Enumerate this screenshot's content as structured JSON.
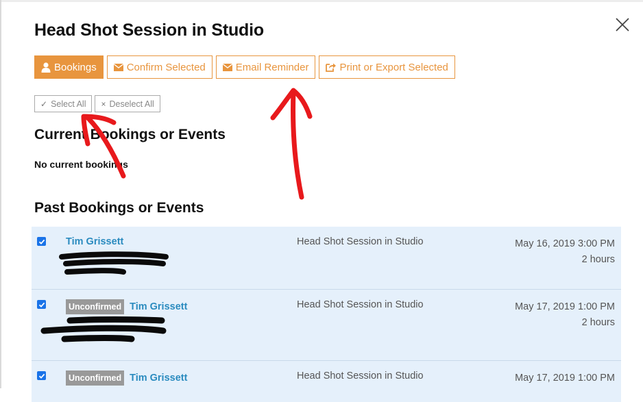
{
  "modal": {
    "title": "Head Shot Session in Studio"
  },
  "toolbar": {
    "bookings_label": "Bookings",
    "confirm_label": "Confirm Selected",
    "email_label": "Email Reminder",
    "print_label": "Print or Export Selected"
  },
  "selection": {
    "select_all": "Select All",
    "deselect_all": "Deselect All"
  },
  "current": {
    "heading": "Current Bookings or Events",
    "empty": "No current bookings"
  },
  "past": {
    "heading": "Past Bookings or Events",
    "rows": [
      {
        "checked": true,
        "badge": "",
        "name": "Tim Grissett",
        "service": "Head Shot Session in Studio",
        "datetime": "May 16, 2019 3:00 PM",
        "duration": "2 hours"
      },
      {
        "checked": true,
        "badge": "Unconfirmed",
        "name": "Tim Grissett",
        "service": "Head Shot Session in Studio",
        "datetime": "May 17, 2019 1:00 PM",
        "duration": "2 hours"
      },
      {
        "checked": true,
        "badge": "Unconfirmed",
        "name": "Tim Grissett",
        "service": "Head Shot Session in Studio",
        "datetime": "May 17, 2019 1:00 PM",
        "duration": ""
      }
    ]
  },
  "colors": {
    "accent": "#e8953e",
    "row_bg": "#e5f0fb",
    "link": "#2a8bbf",
    "annotation": "#e8191c",
    "badge": "#999999"
  },
  "icons": {
    "bookings": "user-icon",
    "confirm": "envelope-icon",
    "email": "envelope-icon",
    "print": "share-icon",
    "select_all": "check-icon",
    "deselect_all": "x-icon",
    "close": "close-icon"
  }
}
